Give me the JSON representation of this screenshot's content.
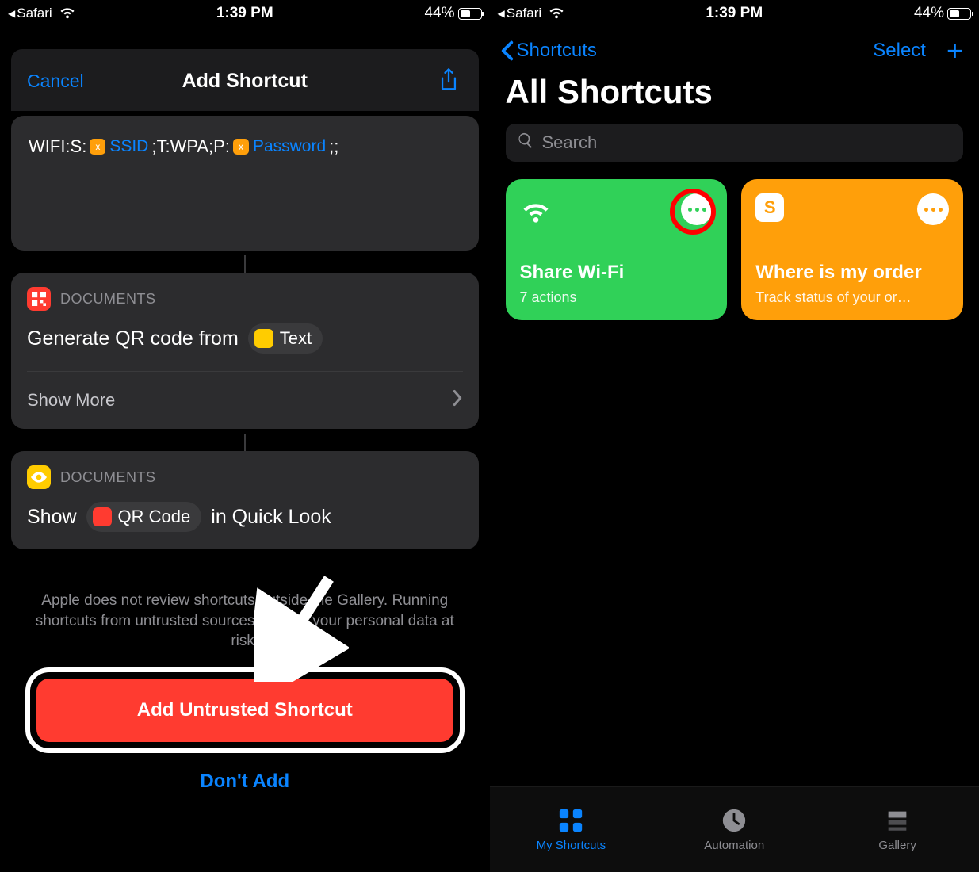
{
  "status": {
    "return_app": "Safari",
    "time": "1:39 PM",
    "battery_pct": "44%",
    "battery_fill_pct": 44
  },
  "left": {
    "header": {
      "cancel": "Cancel",
      "title": "Add Shortcut"
    },
    "wifi_template": {
      "p1": "WIFI:S:",
      "var1": "SSID",
      "p2": ";T:WPA;P:",
      "var2": "Password",
      "p3": ";;"
    },
    "doc1": {
      "label": "DOCUMENTS",
      "action": "Generate QR code from",
      "pill": "Text",
      "show_more": "Show More"
    },
    "doc2": {
      "label": "DOCUMENTS",
      "a1": "Show",
      "pill": "QR Code",
      "a2": "in Quick Look"
    },
    "warning": "Apple does not review shortcuts outside the Gallery. Running shortcuts from untrusted sources can put your personal data at risk.",
    "cta": "Add Untrusted Shortcut",
    "dont_add": "Don't Add"
  },
  "right": {
    "nav": {
      "back": "Shortcuts",
      "select": "Select"
    },
    "title": "All Shortcuts",
    "search_placeholder": "Search",
    "tiles": [
      {
        "title": "Share Wi-Fi",
        "sub": "7 actions"
      },
      {
        "title": "Where is my order",
        "sub": "Track status of your or…"
      }
    ],
    "tabs": {
      "shortcuts": "My Shortcuts",
      "automation": "Automation",
      "gallery": "Gallery"
    }
  }
}
